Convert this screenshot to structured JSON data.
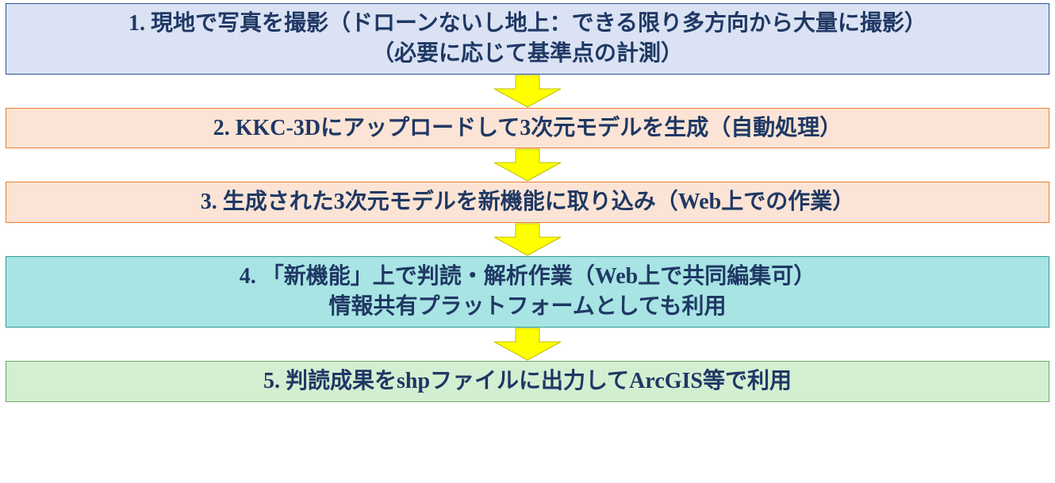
{
  "steps": [
    {
      "lines": [
        "1. 現地で写真を撮影（ドローンないし地上：できる限り多方向から大量に撮影）",
        "（必要に応じて基準点の計測）"
      ],
      "bgClass": "bg-blue"
    },
    {
      "lines": [
        "2. KKC-3Dにアップロードして3次元モデルを生成（自動処理）"
      ],
      "bgClass": "bg-orange"
    },
    {
      "lines": [
        "3. 生成された3次元モデルを新機能に取り込み（Web上での作業）"
      ],
      "bgClass": "bg-orange"
    },
    {
      "lines": [
        "4. 「新機能」上で判読・解析作業（Web上で共同編集可）",
        "情報共有プラットフォームとしても利用"
      ],
      "bgClass": "bg-teal"
    },
    {
      "lines": [
        "5. 判読成果をshpファイルに出力してArcGIS等で利用"
      ],
      "bgClass": "bg-green"
    }
  ],
  "arrow": {
    "fill": "#ffff00",
    "stroke": "#bfbf00"
  },
  "chart_data": {
    "type": "diagram-flow",
    "title": "",
    "nodes": [
      {
        "id": 1,
        "text": "現地で写真を撮影（ドローンないし地上：できる限り多方向から大量に撮影）（必要に応じて基準点の計測）"
      },
      {
        "id": 2,
        "text": "KKC-3Dにアップロードして3次元モデルを生成（自動処理）"
      },
      {
        "id": 3,
        "text": "生成された3次元モデルを新機能に取り込み（Web上での作業）"
      },
      {
        "id": 4,
        "text": "「新機能」上で判読・解析作業（Web上で共同編集可） 情報共有プラットフォームとしても利用"
      },
      {
        "id": 5,
        "text": "判読成果をshpファイルに出力してArcGIS等で利用"
      }
    ],
    "edges": [
      {
        "from": 1,
        "to": 2
      },
      {
        "from": 2,
        "to": 3
      },
      {
        "from": 3,
        "to": 4
      },
      {
        "from": 4,
        "to": 5
      }
    ]
  }
}
